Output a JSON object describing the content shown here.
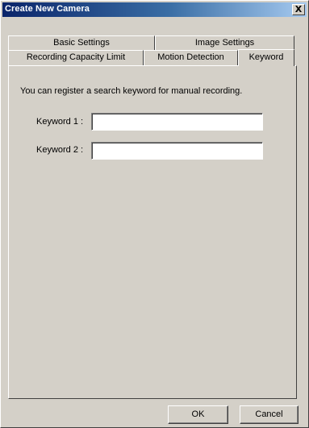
{
  "window": {
    "title": "Create New Camera",
    "close_glyph": "X"
  },
  "tabs": {
    "row_back": [
      {
        "label": "Basic Settings"
      },
      {
        "label": "Image Settings"
      }
    ],
    "row_front": [
      {
        "label": "Recording Capacity Limit"
      },
      {
        "label": "Motion Detection"
      },
      {
        "label": "Keyword",
        "selected": true
      }
    ]
  },
  "keyword_panel": {
    "description": "You can register a search keyword for manual recording.",
    "keyword1_label": "Keyword 1 :",
    "keyword1_value": "",
    "keyword2_label": "Keyword 2 :",
    "keyword2_value": ""
  },
  "buttons": {
    "ok": "OK",
    "cancel": "Cancel"
  },
  "colors": {
    "title_bar": "#0a246a",
    "title_bar_gradient_end": "#a6caf0",
    "dialog_face": "#d4d0c8"
  },
  "icons": {
    "close": "close-icon"
  }
}
